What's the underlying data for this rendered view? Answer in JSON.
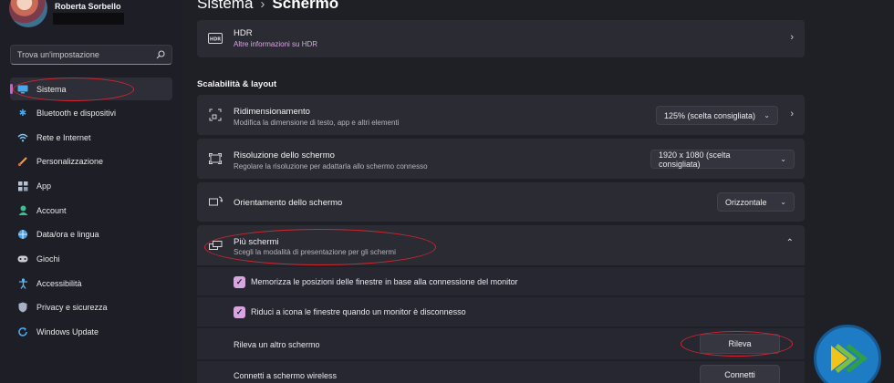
{
  "profile": {
    "name": "Roberta Sorbello"
  },
  "search": {
    "placeholder": "Trova un'impostazione"
  },
  "sidebar": {
    "items": [
      {
        "label": "Sistema",
        "icon": "monitor-icon",
        "active": true
      },
      {
        "label": "Bluetooth e dispositivi",
        "icon": "bluetooth-icon"
      },
      {
        "label": "Rete e Internet",
        "icon": "wifi-icon"
      },
      {
        "label": "Personalizzazione",
        "icon": "brush-icon"
      },
      {
        "label": "App",
        "icon": "apps-icon"
      },
      {
        "label": "Account",
        "icon": "person-icon"
      },
      {
        "label": "Data/ora e lingua",
        "icon": "globe-clock-icon"
      },
      {
        "label": "Giochi",
        "icon": "gamepad-icon"
      },
      {
        "label": "Accessibilità",
        "icon": "accessibility-icon"
      },
      {
        "label": "Privacy e sicurezza",
        "icon": "shield-icon"
      },
      {
        "label": "Windows Update",
        "icon": "update-icon"
      }
    ]
  },
  "breadcrumb": {
    "parent": "Sistema",
    "current": "Schermo"
  },
  "hdr": {
    "title": "HDR",
    "subtitle": "Altre informazioni su HDR",
    "icon_text": "HDR"
  },
  "section": {
    "label": "Scalabilità & layout"
  },
  "scale": {
    "title": "Ridimensionamento",
    "subtitle": "Modifica la dimensione di testo, app e altri elementi",
    "value": "125% (scelta consigliata)"
  },
  "resolution": {
    "title": "Risoluzione dello schermo",
    "subtitle": "Regolare la risoluzione per adattarla allo schermo connesso",
    "value": "1920 x 1080 (scelta consigliata)"
  },
  "orientation": {
    "title": "Orientamento dello schermo",
    "value": "Orizzontale"
  },
  "multi": {
    "title": "Più schermi",
    "subtitle": "Scegli la modalità di presentazione per gli schermi",
    "options": [
      {
        "label": "Memorizza le posizioni delle finestre in base alla connessione del monitor",
        "checked": true
      },
      {
        "label": "Riduci a icona le finestre quando un monitor è disconnesso",
        "checked": true
      }
    ],
    "detect": {
      "label": "Rileva un altro schermo",
      "button": "Rileva"
    },
    "wireless": {
      "label": "Connetti a schermo wireless",
      "button": "Connetti"
    }
  },
  "colors": {
    "accent": "#c95fd6",
    "annotation": "#d4262f",
    "background": "#1f1f26",
    "card": "#2a2b33"
  }
}
